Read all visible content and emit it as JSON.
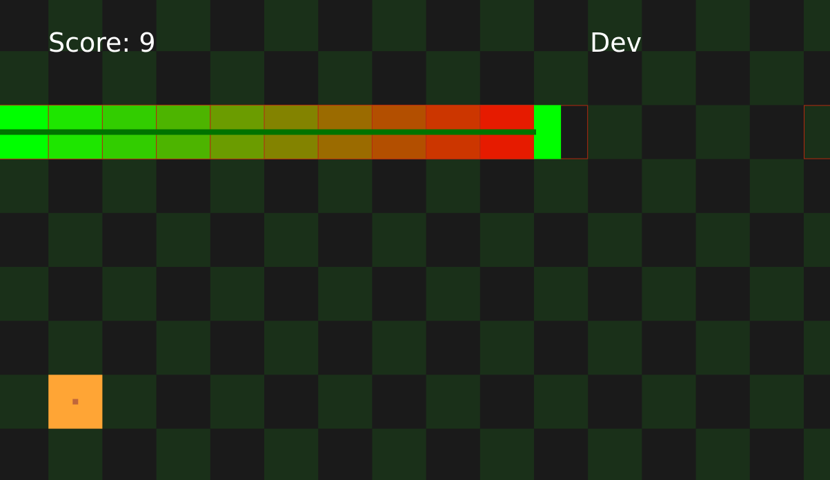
{
  "hud": {
    "score_label": "Score:",
    "score_value": 9,
    "mode_label": "Dev"
  },
  "board": {
    "cols": 16,
    "rows": 9,
    "checker_color_a": "#1a1a1a",
    "checker_color_b": "#1a3019",
    "cell_outline_color": "#b42a10"
  },
  "snake": {
    "direction": "right",
    "segments": [
      {
        "col": 0,
        "row": 2,
        "color": "#00ff00"
      },
      {
        "col": 1,
        "row": 2,
        "color": "#1ee600"
      },
      {
        "col": 2,
        "row": 2,
        "color": "#32cd00"
      },
      {
        "col": 3,
        "row": 2,
        "color": "#4db400"
      },
      {
        "col": 4,
        "row": 2,
        "color": "#6b9c00"
      },
      {
        "col": 5,
        "row": 2,
        "color": "#838300"
      },
      {
        "col": 6,
        "row": 2,
        "color": "#9b6b00"
      },
      {
        "col": 7,
        "row": 2,
        "color": "#b34f00"
      },
      {
        "col": 8,
        "row": 2,
        "color": "#cc3600"
      },
      {
        "col": 9,
        "row": 2,
        "color": "#e61b00"
      }
    ],
    "head": {
      "col": 10,
      "row": 2,
      "color": "#00ff00"
    },
    "spine_color": "#007300"
  },
  "food": {
    "col": 1,
    "row": 7,
    "color": "#ffa535",
    "dot_color": "#c0663a"
  },
  "outlined_cells": [
    {
      "col": 10,
      "row": 2
    },
    {
      "col": 15,
      "row": 2
    }
  ]
}
